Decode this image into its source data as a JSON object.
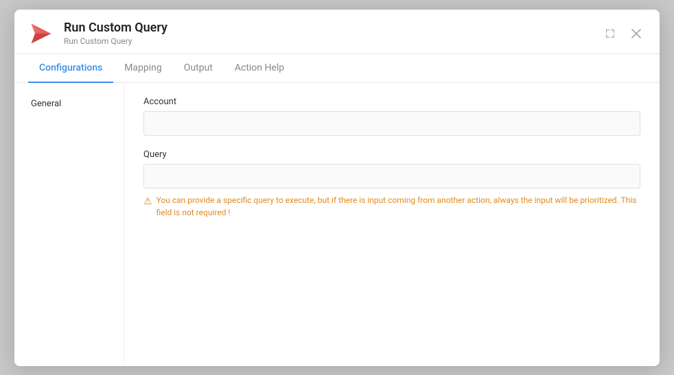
{
  "modal": {
    "title": "Run Custom Query",
    "subtitle": "Run Custom Query",
    "expand_label": "expand",
    "close_label": "close"
  },
  "tabs": [
    {
      "id": "configurations",
      "label": "Configurations",
      "active": true
    },
    {
      "id": "mapping",
      "label": "Mapping",
      "active": false
    },
    {
      "id": "output",
      "label": "Output",
      "active": false
    },
    {
      "id": "action-help",
      "label": "Action Help",
      "active": false
    }
  ],
  "sidebar": {
    "items": [
      {
        "id": "general",
        "label": "General"
      }
    ]
  },
  "fields": {
    "account": {
      "label": "Account",
      "placeholder": "",
      "value": ""
    },
    "query": {
      "label": "Query",
      "placeholder": "",
      "value": "",
      "hint": "You can provide a specific query to execute, but if there is input coming from another action, always the input will be prioritized. This field is not required !"
    }
  }
}
